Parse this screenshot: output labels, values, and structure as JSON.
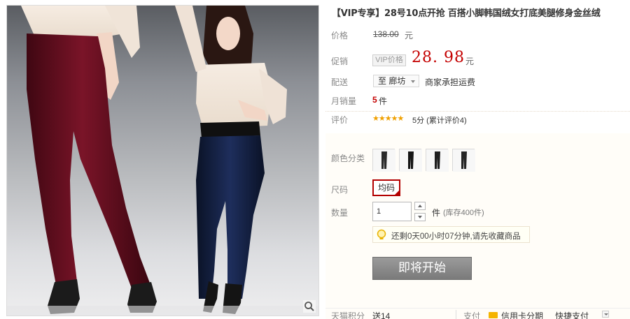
{
  "product": {
    "title": "【VIP专享】28号10点开抢 百搭小脚韩国绒女打底美腿修身金丝绒"
  },
  "labels": {
    "price": "价格",
    "promo": "促销",
    "shipping": "配送",
    "monthly_sales": "月销量",
    "rating": "评价",
    "color": "颜色分类",
    "size": "尺码",
    "quantity": "数量"
  },
  "price": {
    "original": "138.00",
    "original_unit": "元",
    "vip_tag": "VIP价格",
    "promo": "28. 98",
    "promo_unit": "元",
    "price_color": "#c40000"
  },
  "shipping": {
    "destination": "至 廊坊",
    "note": "商家承担运费"
  },
  "sales": {
    "count": "5",
    "unit": "件"
  },
  "rating": {
    "stars": "★★★★★",
    "text": "5分 (累计评价4)"
  },
  "sku": {
    "colors": [
      "color-1",
      "color-2",
      "color-3",
      "color-4"
    ],
    "size_selected": "均码",
    "quantity_value": "1",
    "quantity_unit": "件",
    "stock": "(库存400件)"
  },
  "notice": {
    "icon": "lightbulb-icon",
    "text": "还剩0天00小时07分钟,请先收藏商品"
  },
  "action": {
    "start_label": "即将开始"
  },
  "bottom": {
    "points_label": "天猫积分",
    "points_value": "送14",
    "pay_label": "支付",
    "installment": "信用卡分期",
    "quick_pay": "快捷支付"
  }
}
